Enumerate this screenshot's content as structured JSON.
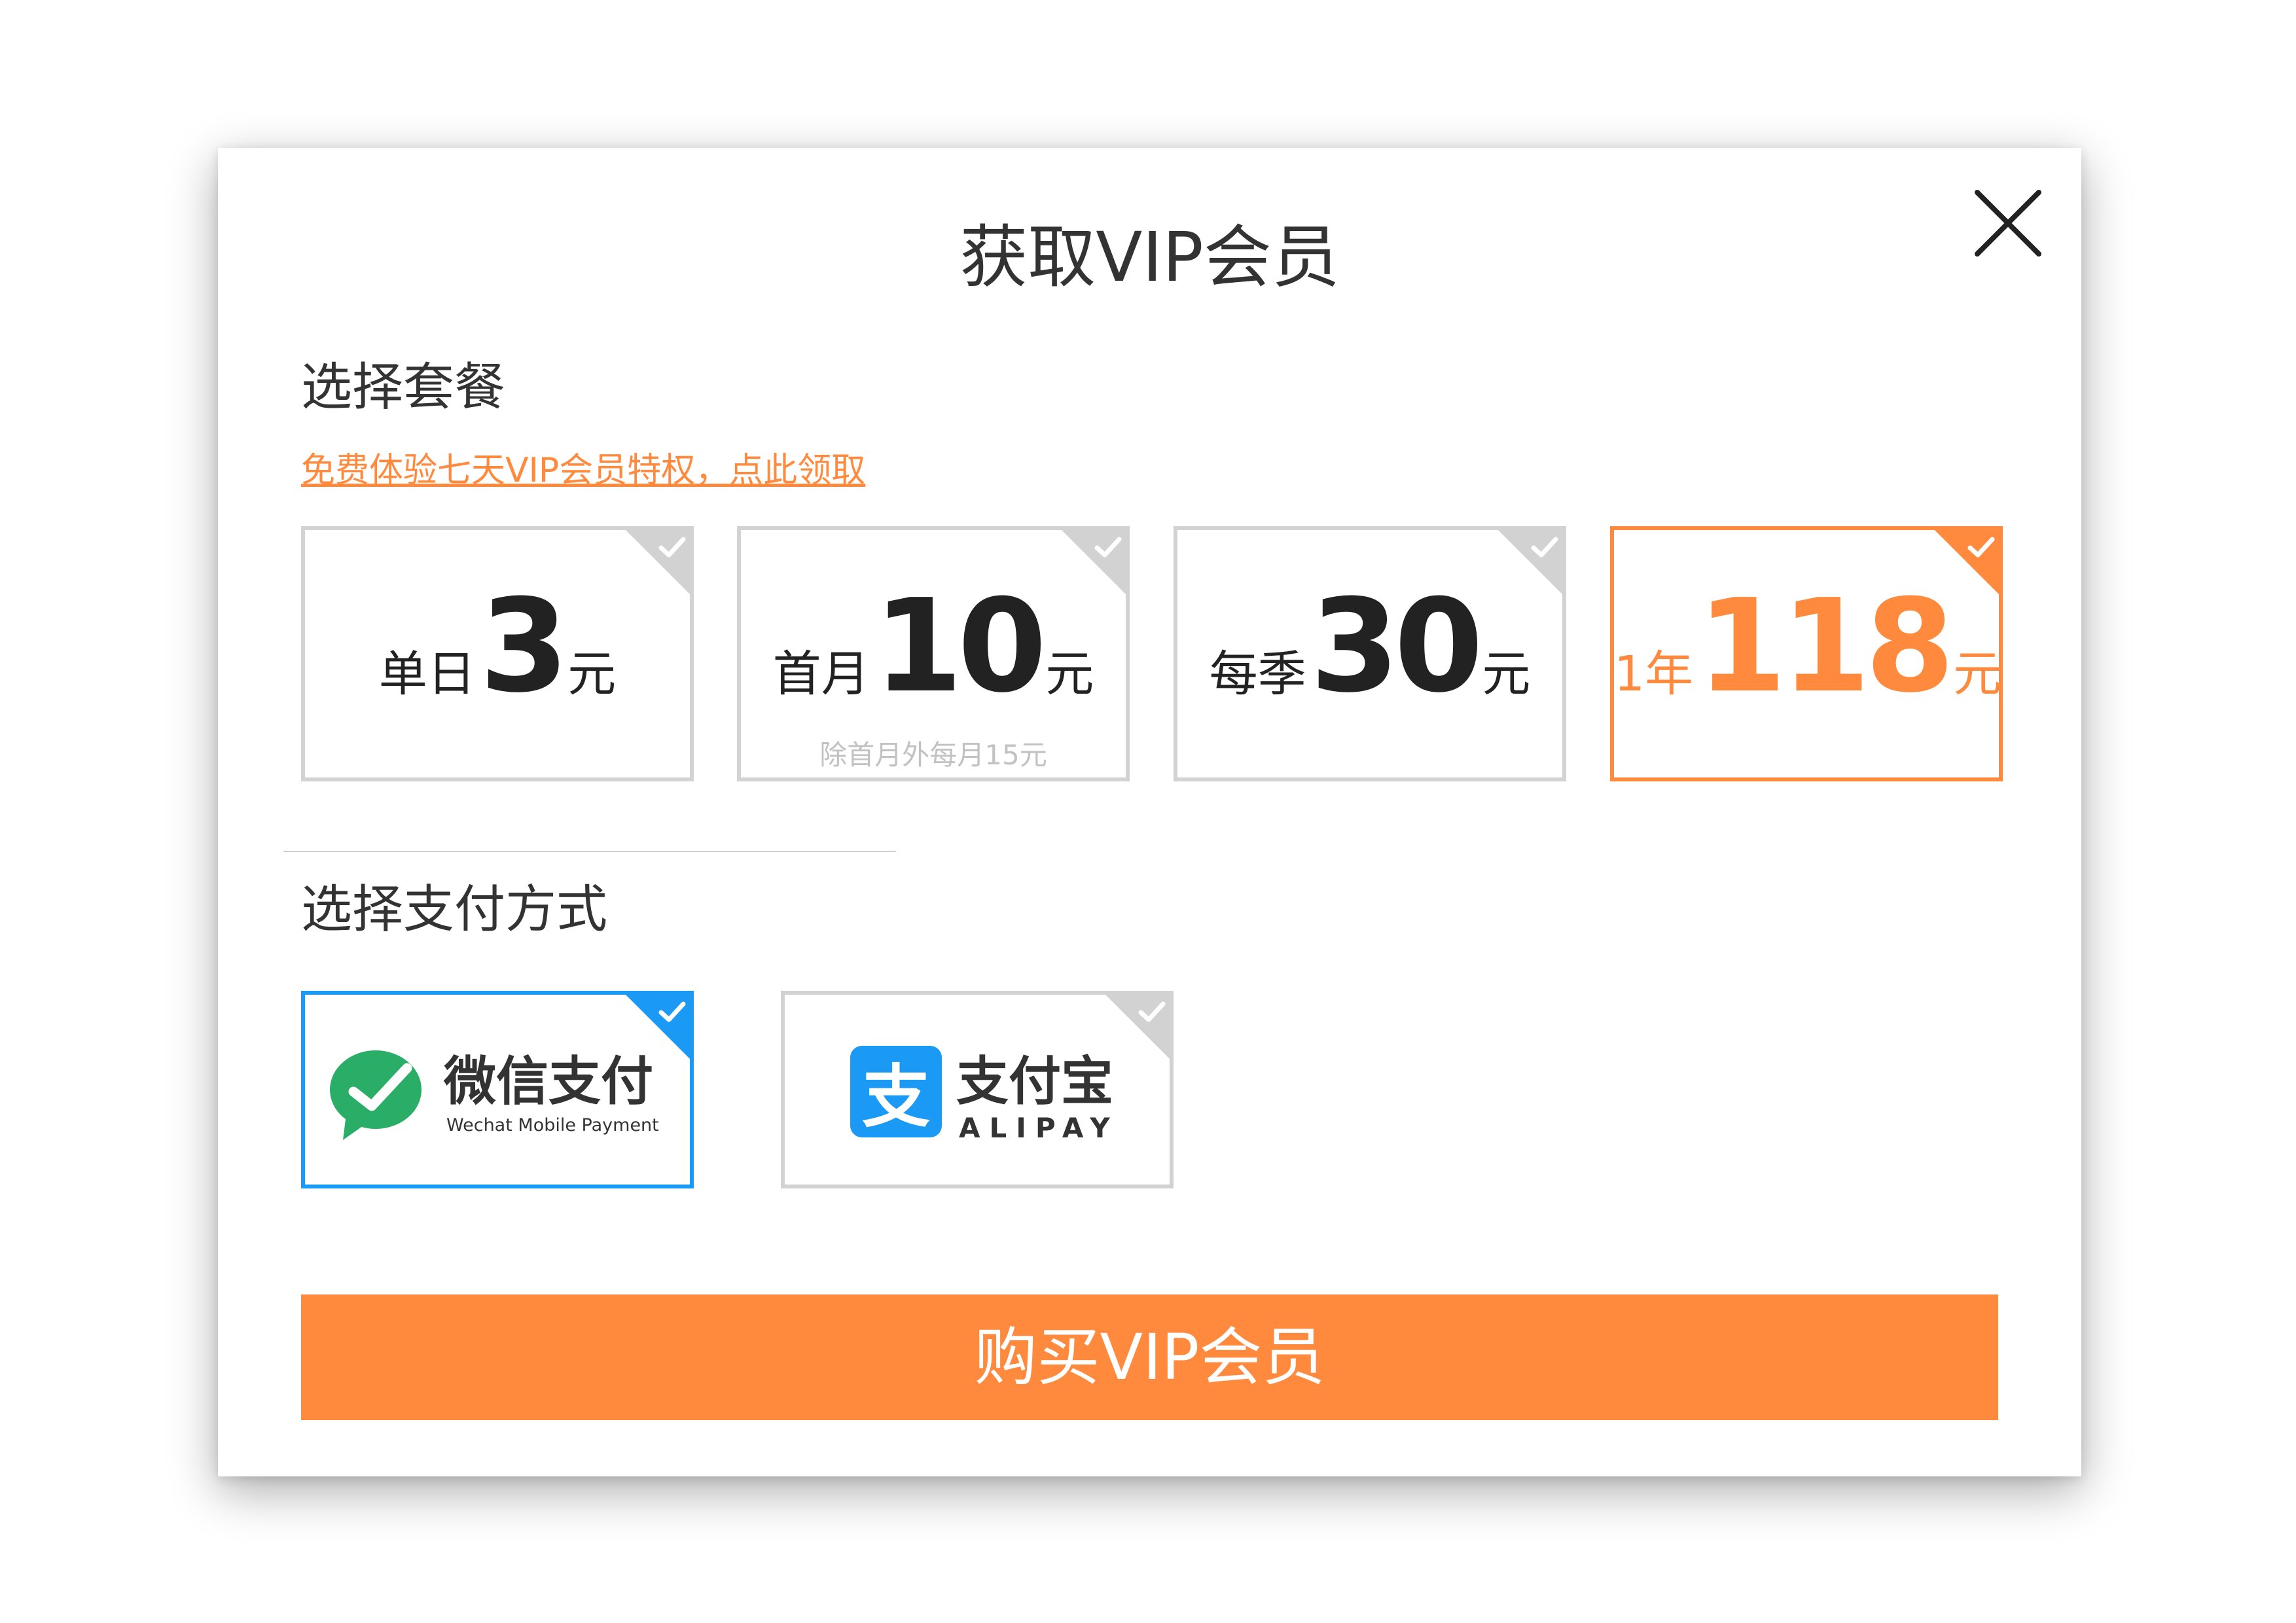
{
  "dialog": {
    "title": "获取VIP会员"
  },
  "plans": {
    "heading": "选择套餐",
    "trial_link": "免费体验七天VIP会员特权，点此领取",
    "items": [
      {
        "label": "单日",
        "amount": "3",
        "unit": "元",
        "note": "",
        "selected": false
      },
      {
        "label": "首月",
        "amount": "10",
        "unit": "元",
        "note": "除首月外每月15元",
        "selected": false
      },
      {
        "label": "每季",
        "amount": "30",
        "unit": "元",
        "note": "",
        "selected": false
      },
      {
        "label": "1年",
        "amount": "118",
        "unit": "元",
        "note": "",
        "selected": true
      }
    ]
  },
  "payment": {
    "heading": "选择支付方式",
    "methods": [
      {
        "name": "微信支付",
        "subtitle": "Wechat Mobile Payment",
        "icon": "wechat-pay-logo",
        "selected": true
      },
      {
        "name": "支付宝",
        "subtitle": "ALIPAY",
        "icon": "alipay-logo",
        "selected": false
      }
    ]
  },
  "buy_button": {
    "label": "购买VIP会员"
  },
  "colors": {
    "accent": "#ff8a3d",
    "selected_payment": "#1a9af5",
    "border_default": "#d2d2d2",
    "wechat_green": "#2aae67",
    "alipay_blue": "#1a9af5"
  }
}
